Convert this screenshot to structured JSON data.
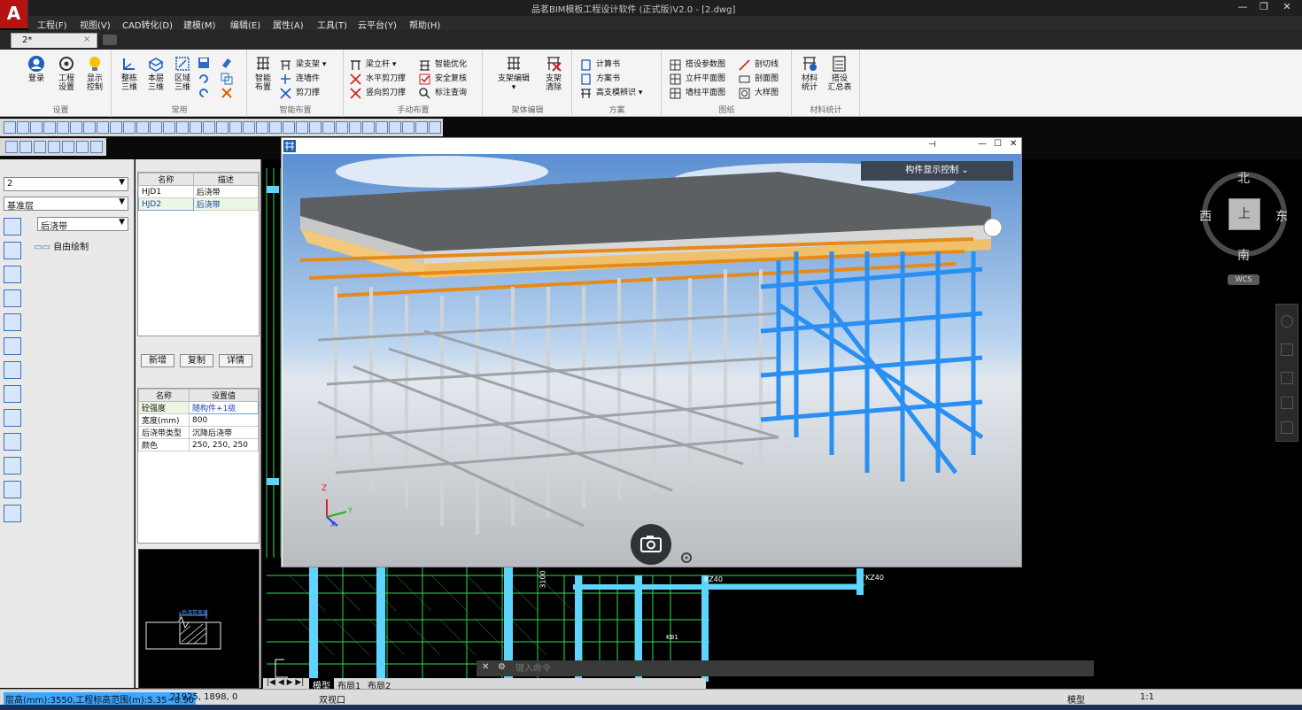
{
  "window": {
    "title": "品茗BIM模板工程设计软件 (正式版)V2.0 - [2.dwg]",
    "logo": "A",
    "minimize": "—",
    "restore": "❐",
    "close": "✕"
  },
  "menu": [
    "工程(F)",
    "视图(V)",
    "CAD转化(D)",
    "建模(M)",
    "编辑(E)",
    "属性(A)",
    "工具(T)",
    "云平台(Y)",
    "帮助(H)"
  ],
  "doc_tab": {
    "label": "2*",
    "close": "×"
  },
  "ribbon": {
    "groups": [
      {
        "label": "设置",
        "big": [
          "登录",
          "工程\n设置",
          "显示\n控制"
        ]
      },
      {
        "label": "常用",
        "big": [
          "整栋\n三维",
          "本层\n三维",
          "区域\n三维"
        ]
      },
      {
        "label": "智能布置",
        "big": [
          "智能\n布置"
        ],
        "small": [
          "梁支架",
          "连墙件",
          "剪刀撑"
        ]
      },
      {
        "label": "手动布置",
        "small": [
          "梁立杆",
          "水平剪刀撑",
          "竖向剪刀撑",
          "智能优化",
          "安全复核",
          "标注查询"
        ]
      },
      {
        "label": "架体编辑",
        "big": [
          "支架编辑",
          "支架\n清除"
        ]
      },
      {
        "label": "方案",
        "small": [
          "计算书",
          "方案书",
          "高支模辨识"
        ]
      },
      {
        "label": "图纸",
        "small": [
          "搭设参数图",
          "立杆平面图",
          "墙柱平面图",
          "剖切线",
          "剖面图",
          "大样图"
        ]
      },
      {
        "label": "材料统计",
        "big": [
          "材料\n统计",
          "搭设\n汇总表"
        ]
      }
    ]
  },
  "left_panel": {
    "floor_combo": "2",
    "layer_combo": "基准层",
    "type_combo": "后浇带",
    "tree_item": "自由绘制"
  },
  "component_table": {
    "headers": [
      "名称",
      "描述"
    ],
    "rows": [
      {
        "name": "HJD1",
        "desc": "后浇带"
      },
      {
        "name": "HJD2",
        "desc": "后浇带"
      }
    ]
  },
  "actions": {
    "add": "新增",
    "copy": "复制",
    "detail": "详情"
  },
  "property_table": {
    "headers": [
      "名称",
      "设置值"
    ],
    "rows": [
      {
        "name": "砼强度",
        "value": "随构件+1级"
      },
      {
        "name": "宽度(mm)",
        "value": "800"
      },
      {
        "name": "后浇带类型",
        "value": "沉降后浇带"
      },
      {
        "name": "颜色",
        "value": "250, 250, 250"
      }
    ]
  },
  "preview": {
    "label": "后浇带宽度"
  },
  "view3d": {
    "component_control": "构件显示控制",
    "pin": "⊣",
    "minimize": "—",
    "maximize": "☐",
    "close": "✕",
    "axis_z": "Z",
    "axis_y": "Y",
    "axis_x": "X"
  },
  "navcube": {
    "north": "北",
    "south": "南",
    "east": "东",
    "west": "西",
    "top": "上",
    "wcs": "WCS"
  },
  "cad": {
    "label_kz40_a": "KZ40",
    "label_kz40_b": "KZ40",
    "label_3100": "3100",
    "label_kb1": "KB1"
  },
  "layout_tabs": [
    "模型",
    "布局1",
    "布局2"
  ],
  "command_line": {
    "placeholder": "键入命令"
  },
  "status": {
    "floor_info": "层高(mm):3550,工程标高范围(m):5.35~8.90",
    "coords": "21925, 1898, 0",
    "viewport": "双视口",
    "model": "模型",
    "scale": "1:1"
  }
}
